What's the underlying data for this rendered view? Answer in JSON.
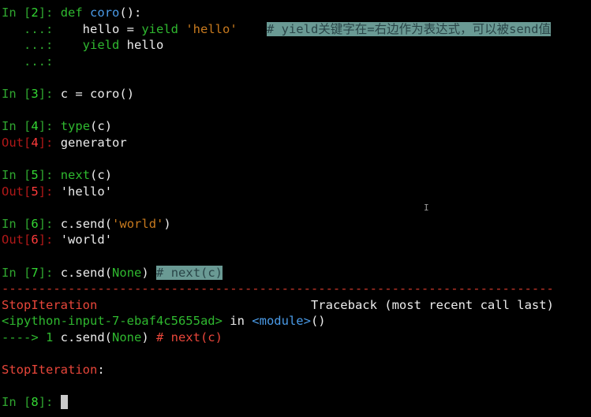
{
  "prompts": {
    "in": "In ",
    "out": "Out",
    "cont": "   ...:",
    "lb": "[",
    "rb": "]",
    "colon": ": "
  },
  "cell2": {
    "num": "2",
    "def": "def",
    "name": "coro",
    "sig": "():",
    "l2_indent": "    hello = ",
    "yield": "yield",
    "space": " ",
    "str_hello": "'hello'",
    "gap": "    ",
    "comment": "# yield关键字在=右边作为表达式，可以被send值",
    "l3_indent": "    ",
    "l3_rest": " hello"
  },
  "cell3": {
    "num": "3",
    "code": "c = coro()"
  },
  "cell4": {
    "num": "4",
    "fn": "type",
    "args": "(c)",
    "out": "generator"
  },
  "cell5": {
    "num": "5",
    "fn": "next",
    "args": "(c)",
    "out": "'hello'"
  },
  "cell6": {
    "num": "6",
    "pre": "c.send(",
    "arg": "'world'",
    "post": ")",
    "out": "'world'"
  },
  "cell7": {
    "num": "7",
    "pre": "c.send(",
    "none": "None",
    "post": ") ",
    "comment": "# next(c)"
  },
  "traceback": {
    "dashes": "---------------------------------------------------------------------------",
    "exc_name": "StopIteration",
    "header_gap": "                             ",
    "header": "Traceback (most recent call last)",
    "input_ref": "<ipython-input-7-ebaf4c5655ad>",
    "in_word": " in ",
    "module": "<module>",
    "module_parens": "()",
    "arrow": "----> 1",
    "code_pre": " c.send(",
    "code_none": "None",
    "code_post": ") ",
    "code_comment": "# next(c)",
    "final": "StopIteration",
    "final_colon": ":"
  },
  "cell8": {
    "num": "8"
  },
  "colors": {
    "background": "#000000",
    "text": "#ececec",
    "prompt": "#2fa52f",
    "error": "#e8463a",
    "string": "#c87a1e",
    "function": "#4a9be8",
    "comment_highlight": "#6a9a94",
    "cursor": "#c9c9c9"
  },
  "icons": {
    "text_cursor": "i-beam-icon",
    "caret": "block-cursor-icon"
  },
  "ibeam_glyph": "I"
}
